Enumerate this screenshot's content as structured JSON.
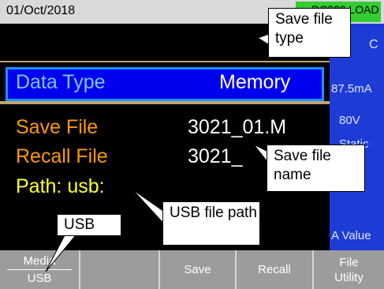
{
  "status_bar": {
    "date": "01/Oct/2018",
    "mode": "DC302 LOAD"
  },
  "right_panel": {
    "c": "C",
    "current": "87.5mA",
    "voltage": "80V",
    "mode": "Static",
    "a_value": "A Value"
  },
  "main": {
    "data_type": {
      "label": "Data Type",
      "value": "Memory"
    },
    "save_file": {
      "label": "Save File",
      "value": "3021_01.M"
    },
    "recall_file": {
      "label": "Recall File",
      "value": "3021_"
    },
    "path": {
      "label": "Path: usb:"
    }
  },
  "softkeys": {
    "media_top": "Media",
    "media_bottom": "USB",
    "save": "Save",
    "recall": "Recall",
    "file_top": "File",
    "file_bottom": "Utility"
  },
  "callouts": {
    "save_file_type": "Save file type",
    "save_file_name": "Save file name",
    "usb_file_path": "USB file path",
    "usb": "USB"
  },
  "colors": {
    "status_bar": "#d9d9d9",
    "mode_badge": "#33cc33",
    "right_panel": "#1f3bd6",
    "data_type_row": "#0000ee",
    "label_orange": "#ff9900",
    "label_yellow": "#ffff33",
    "softkey": "#9c9c9c"
  }
}
